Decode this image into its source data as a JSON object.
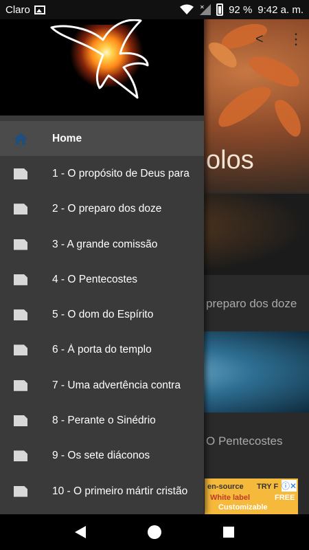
{
  "status_bar": {
    "carrier": "Claro",
    "battery": "92 %",
    "time": "9:42 a. m."
  },
  "background": {
    "hero_title_partial": "olos",
    "card1_label": "preparo dos doze",
    "card2_label": "O Pentecostes",
    "ad": {
      "line1": "en-source",
      "line1_right": "TRY F",
      "line2": "White label",
      "line2_right": "FREE",
      "line3": "Customizable"
    }
  },
  "drawer": {
    "items": [
      {
        "label": "Home",
        "icon": "home-icon",
        "active": true
      },
      {
        "label": "1 - O propósito de Deus para",
        "icon": "page-icon"
      },
      {
        "label": "2 - O preparo dos doze",
        "icon": "page-icon"
      },
      {
        "label": "3 - A grande comissão",
        "icon": "page-icon"
      },
      {
        "label": "4 - O Pentecostes",
        "icon": "page-icon"
      },
      {
        "label": "5 - O dom do Espírito",
        "icon": "page-icon"
      },
      {
        "label": "6 - À porta do templo",
        "icon": "page-icon"
      },
      {
        "label": "7 - Uma advertência contra",
        "icon": "page-icon"
      },
      {
        "label": "8 - Perante o Sinédrio",
        "icon": "page-icon"
      },
      {
        "label": "9 - Os sete diáconos",
        "icon": "page-icon"
      },
      {
        "label": "10 - O primeiro mártir cristão",
        "icon": "page-icon"
      }
    ]
  },
  "colors": {
    "drawer_bg": "#3a3a3a",
    "active_item_bg": "#4b4b4b",
    "home_icon": "#1f4f7a"
  }
}
